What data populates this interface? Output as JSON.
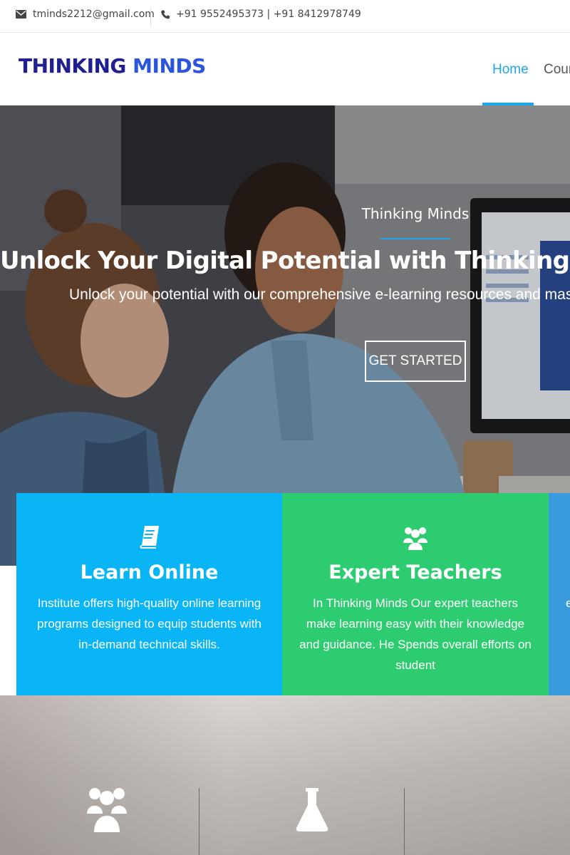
{
  "topbar": {
    "email": "tminds2212@gmail.com",
    "phone": "+91 9552495373 | +91 8412978749"
  },
  "header": {
    "logo_part1": "THINKING",
    "logo_part2": "MINDS",
    "nav": [
      {
        "label": "Home",
        "active": true
      },
      {
        "label": "Cours",
        "active": false
      }
    ]
  },
  "hero": {
    "eyebrow": "Thinking Minds",
    "title": "Unlock Your Digital Potential with ThinkingMinds Te",
    "subtitle": "Unlock your potential with our comprehensive e-learning resources and master the sk",
    "button": "GET STARTED"
  },
  "features": [
    {
      "icon": "book-icon",
      "title": "Learn Online",
      "text": "Institute offers high-quality online learning programs designed to equip students with in-demand technical skills."
    },
    {
      "icon": "users-icon",
      "title": "Expert Teachers",
      "text": "In Thinking Minds Our expert teachers make learning easy with their knowledge and guidance. He Spends overall efforts on student"
    },
    {
      "icon": "",
      "title": "",
      "text": "e"
    }
  ],
  "colors": {
    "accent": "#1ea7e8",
    "card_blue": "#09b5f5",
    "card_green": "#2ecc71",
    "card_third": "#3a9bdc",
    "logo_dark": "#1f1f8f",
    "logo_light": "#2b56d9"
  },
  "bottom_icons": [
    "users-icon",
    "flask-icon"
  ]
}
